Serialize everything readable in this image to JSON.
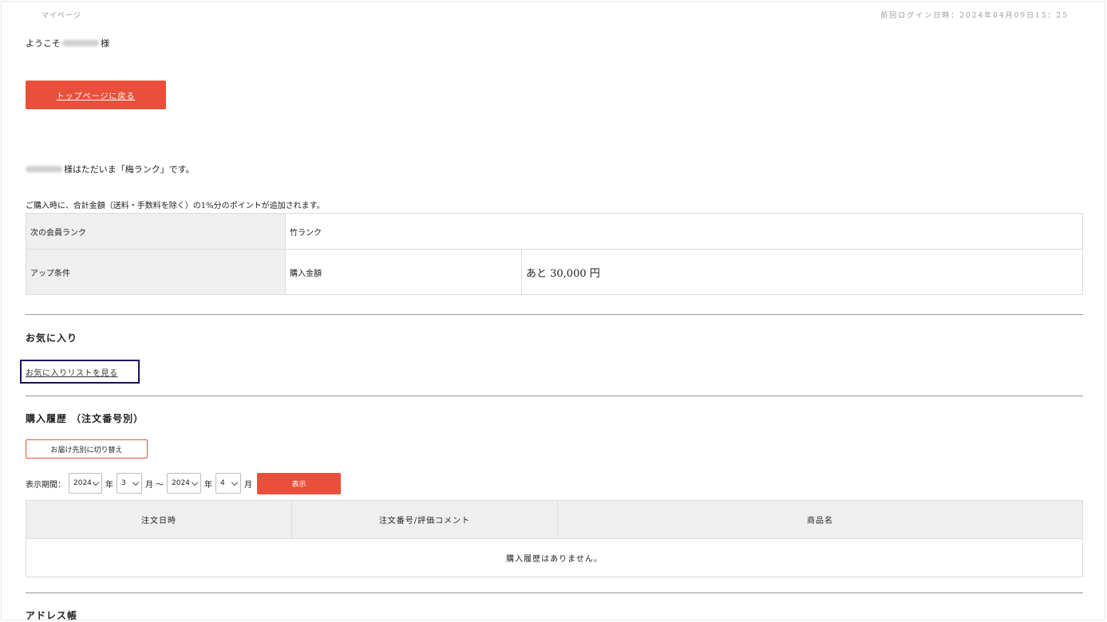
{
  "breadcrumb": "マイページ",
  "last_login": "前回ログイン日時：2024年04月09日15：25",
  "welcome": {
    "prefix": "ようこそ",
    "suffix": " 様"
  },
  "top_button": "トップページに戻る",
  "rank_message": "様はただいま「梅ランク」です。",
  "points_note": "ご購入時に、合計金額（送料・手数料を除く）の1%分のポイントが追加されます。",
  "rank_table": {
    "next_rank_label": "次の会員ランク",
    "next_rank_value": "竹ランク",
    "condition_label": "アップ条件",
    "condition_type": "購入金額",
    "condition_value": "あと 30,000 円"
  },
  "favorites": {
    "title": "お気に入り",
    "link": "お気に入りリストを見る"
  },
  "history": {
    "title": "購入履歴 （注文番号別）",
    "switch_button": "お届け先別に切り替え",
    "period_label": "表示期間：",
    "from_year": "2024",
    "year_label": "年",
    "from_month": "3",
    "month_label": "月",
    "tilde": "〜",
    "to_year": "2024",
    "to_month": "4",
    "show_button": "表示",
    "columns": [
      "注文日時",
      "注文番号/評価コメント",
      "商品名"
    ],
    "empty_message": "購入履歴はありません。"
  },
  "address_book": {
    "title": "アドレス帳"
  }
}
